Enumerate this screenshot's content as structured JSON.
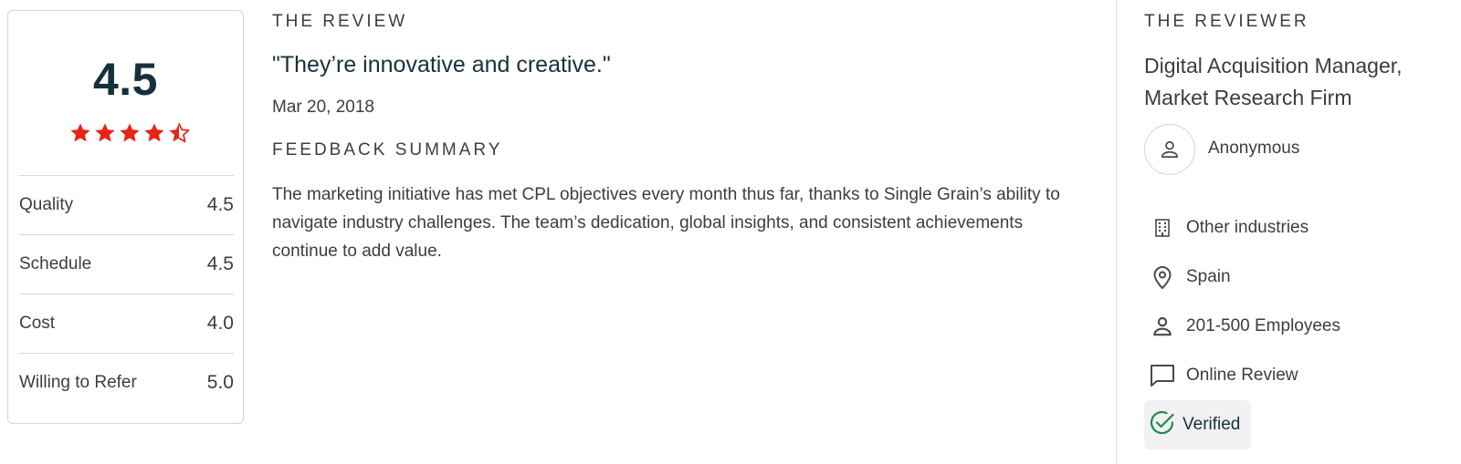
{
  "rating": {
    "overall": "4.5",
    "overall_value": 4.5,
    "star_color": "#e62415",
    "metrics": [
      {
        "label": "Quality",
        "value": "4.5"
      },
      {
        "label": "Schedule",
        "value": "4.5"
      },
      {
        "label": "Cost",
        "value": "4.0"
      },
      {
        "label": "Willing to Refer",
        "value": "5.0"
      }
    ]
  },
  "review": {
    "heading": "THE REVIEW",
    "quote": "\"They’re innovative and creative.\"",
    "date": "Mar 20, 2018",
    "summary_heading": "FEEDBACK SUMMARY",
    "summary": "The marketing initiative has met CPL objectives every month thus far, thanks to Single Grain’s ability to navigate industry challenges. The team’s dedication, global insights, and consistent achievements continue to add value."
  },
  "reviewer": {
    "heading": "THE REVIEWER",
    "title": "Digital Acquisition Manager, Market Research Firm",
    "name": "Anonymous",
    "avatar_icon": "user-icon",
    "details": [
      {
        "icon": "building-icon",
        "text": "Other industries"
      },
      {
        "icon": "location-pin-icon",
        "text": "Spain"
      },
      {
        "icon": "person-icon",
        "text": "201-500 Employees"
      },
      {
        "icon": "chat-bubble-icon",
        "text": "Online Review"
      }
    ],
    "verified": {
      "icon": "check-circle-icon",
      "text": "Verified",
      "color": "#1e8a4c"
    }
  }
}
